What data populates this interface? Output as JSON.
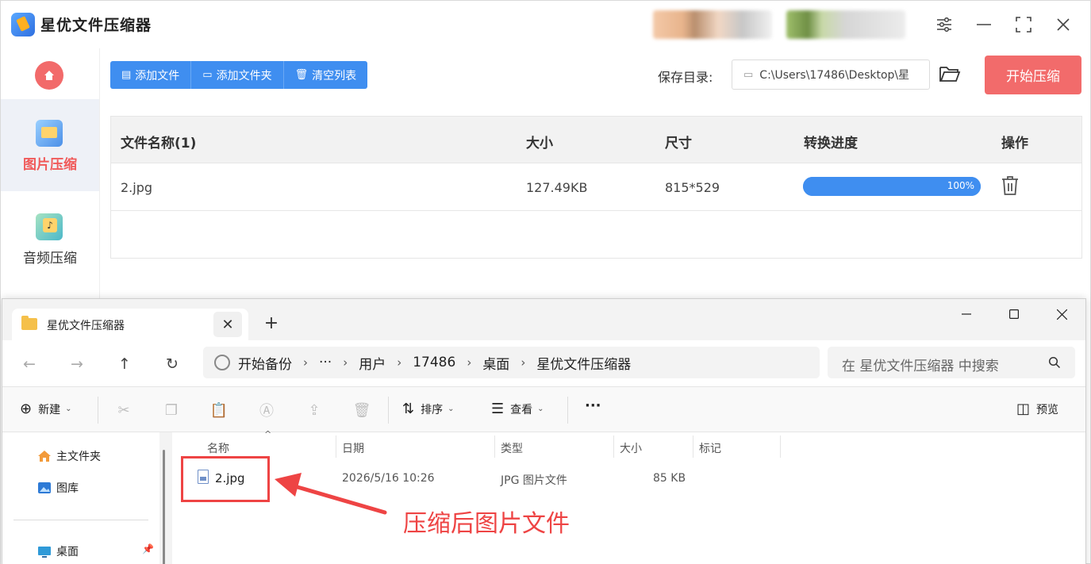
{
  "app": {
    "title": "星优文件压缩器",
    "window_buttons": {
      "settings": "settings-icon",
      "minimize": "—",
      "maximize": "⛶",
      "close": "✕"
    }
  },
  "sidebar": {
    "items": [
      {
        "label": "图片压缩",
        "active": true
      },
      {
        "label": "音频压缩",
        "active": false
      }
    ]
  },
  "toolbar": {
    "add_file": "添加文件",
    "add_folder": "添加文件夹",
    "clear_list": "清空列表",
    "save_dir_label": "保存目录:",
    "save_dir_value": "C:\\Users\\17486\\Desktop\\星",
    "start": "开始压缩"
  },
  "file_table": {
    "headers": [
      "文件名称(1)",
      "大小",
      "尺寸",
      "转换进度",
      "操作"
    ],
    "rows": [
      {
        "name": "2.jpg",
        "size": "127.49KB",
        "dimensions": "815*529",
        "progress": 100,
        "progress_text": "100%"
      }
    ]
  },
  "explorer": {
    "tab_title": "星优文件压缩器",
    "new_tab": "+",
    "address": {
      "root": "开始备份",
      "ellipsis": "···",
      "segments": [
        "用户",
        "17486",
        "桌面",
        "星优文件压缩器"
      ]
    },
    "search_placeholder": "在 星优文件压缩器 中搜索",
    "commands": {
      "new": "新建",
      "sort": "排序",
      "view": "查看",
      "more": "···",
      "preview": "预览"
    },
    "nav": [
      {
        "label": "主文件夹"
      },
      {
        "label": "图库"
      },
      {
        "label": "桌面"
      }
    ],
    "columns": [
      "名称",
      "日期",
      "类型",
      "大小",
      "标记"
    ],
    "files": [
      {
        "name": "2.jpg",
        "date": "2026/5/16 10:26",
        "type": "JPG 图片文件",
        "size": "85 KB"
      }
    ]
  },
  "annotation": {
    "text": "压缩后图片文件",
    "color": "#ee4444"
  },
  "colors": {
    "accent_blue": "#3f8ef0",
    "accent_red": "#f26b6b"
  }
}
